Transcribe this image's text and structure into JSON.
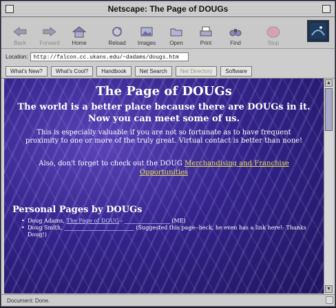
{
  "window": {
    "title": "Netscape: The Page of DOUGs"
  },
  "toolbar": {
    "back": "Back",
    "forward": "Forward",
    "home": "Home",
    "reload": "Reload",
    "images": "Images",
    "open": "Open",
    "print": "Print",
    "find": "Find",
    "stop": "Stop"
  },
  "location": {
    "label": "Location:",
    "url": "http://falcon.cc.ukans.edu/~dadams/dougs.htm"
  },
  "directory": {
    "whats_new": "What's New?",
    "whats_cool": "What's Cool?",
    "handbook": "Handbook",
    "net_search": "Net Search",
    "net_directory": "Net Directory",
    "software": "Software"
  },
  "page": {
    "title": "The Page of DOUGs",
    "lead": "The world is a better place because there are DOUGs in it. Now you can meet some of us.",
    "para": "This is especially valuable if you are not so fortunate as to have frequent proximity to one or more of the truly great. Virtual contact is better than none!",
    "para2_prefix": "Also, don't forget to check out the DOUG",
    "merch_link": "Merchandising and Franchise Opportunities",
    "personal_heading": "Personal Pages by DOUGs",
    "item1_name": "Doug Adams,",
    "item1_link": "The Page of DOUG",
    "item1_suffix": "(ME)",
    "item2_name": "Doug Smith,",
    "item2_suffix": "(Suggested this page--heck, he even has a link here!- Thanks Doug!)"
  },
  "status": {
    "text": "Document: Done."
  }
}
